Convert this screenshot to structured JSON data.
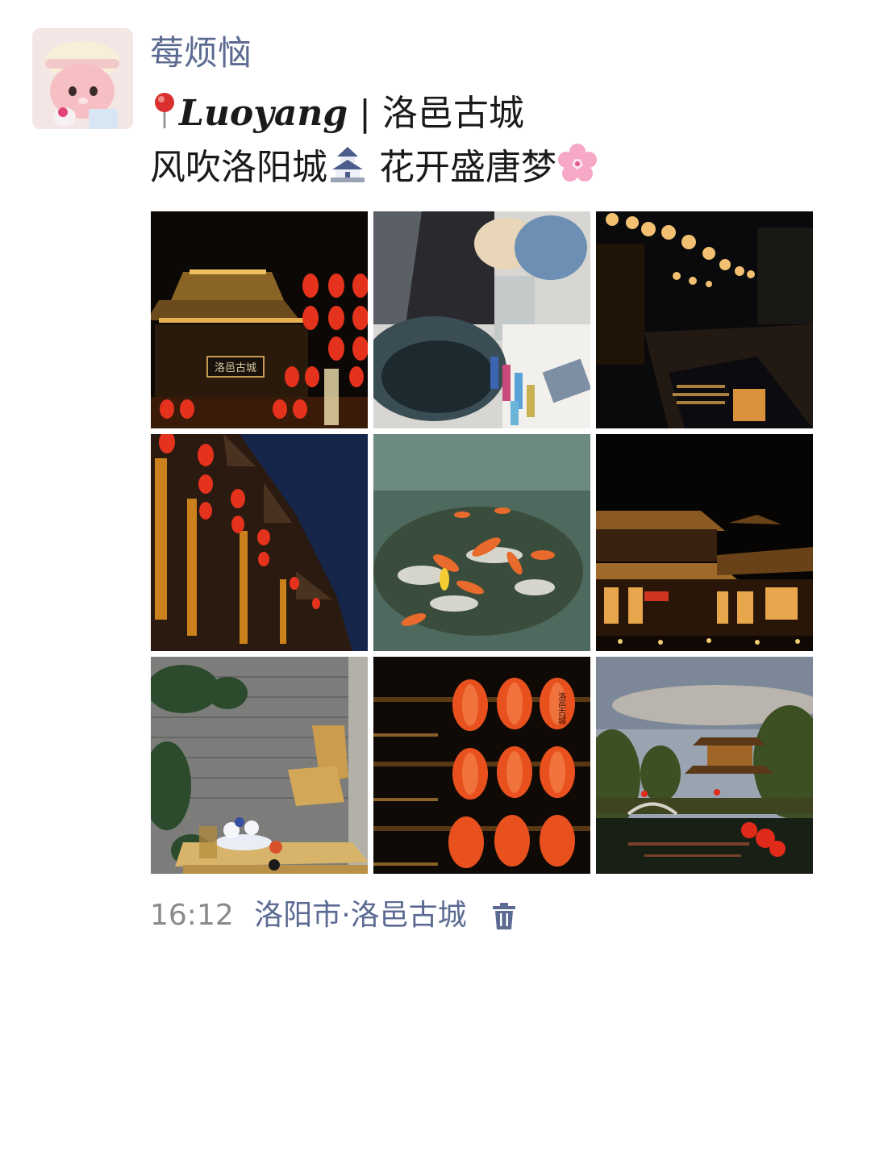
{
  "post": {
    "username": "莓烦恼",
    "avatar_icon": "plush-toy-avatar",
    "text_line1": {
      "pin": "📍",
      "latin": "Luoyang",
      "separator": " | ",
      "chinese": "洛邑古城"
    },
    "text_line2": {
      "part1": "风吹洛阳城",
      "emoji1": "castle-emoji",
      "part2": " 花开盛唐梦",
      "emoji2": "cherry-blossom-emoji"
    },
    "photos": [
      {
        "name": "photo-night-gate-lanterns",
        "caption": "洛邑古城"
      },
      {
        "name": "photo-calligraphy-paint-desk"
      },
      {
        "name": "photo-lantern-street-canal"
      },
      {
        "name": "photo-tower-lanterns-blue-sky"
      },
      {
        "name": "photo-koi-pond"
      },
      {
        "name": "photo-palace-night-lights"
      },
      {
        "name": "photo-teahouse-table"
      },
      {
        "name": "photo-red-lantern-rows",
        "lantern_text": "洛邑古城"
      },
      {
        "name": "photo-garden-pavilion-pond"
      }
    ],
    "time": "16:12",
    "location": "洛阳市·洛邑古城",
    "delete_icon": "trash-icon"
  },
  "colors": {
    "name_blue": "#5b6a92",
    "time_gray": "#8a8a8a",
    "text": "#1a1a1a"
  }
}
